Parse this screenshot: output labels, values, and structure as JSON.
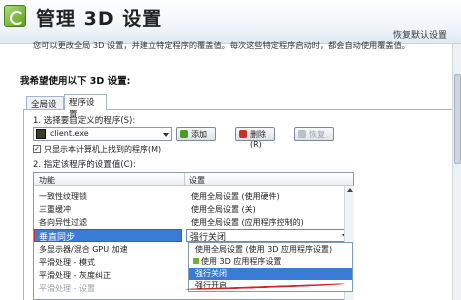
{
  "header": {
    "title": "管理 3D 设置",
    "restore_defaults": "恢复默认设置"
  },
  "description": "您可以更改全局 3D 设置，并建立特定程序的覆盖值。每次这些特定程序启动时，都会自动使用覆盖值。",
  "section_heading": "我希望使用以下 3D 设置:",
  "tabs": [
    {
      "label": "全局设置",
      "active": false
    },
    {
      "label": "程序设置",
      "active": true
    }
  ],
  "program_settings": {
    "step1_label": "1. 选择要自定义的程序(S):",
    "selected_program": "client.exe",
    "add_label": "添加",
    "remove_label": "删除(R)",
    "restore_label": "恢复",
    "checkbox_label": "只显示本计算机上找到的程序(M)",
    "checkbox_checked": true,
    "step2_label": "2. 指定该程序的设置值(C):"
  },
  "settings_table": {
    "columns": [
      "功能",
      "设置"
    ],
    "rows": [
      {
        "feature": "一致性纹理锁",
        "setting": "使用全局设置 (使用硬件)"
      },
      {
        "feature": "三重缓冲",
        "setting": "使用全局设置 (关)"
      },
      {
        "feature": "各向异性过滤",
        "setting": "使用全局设置 (应用程序控制的)"
      },
      {
        "feature": "垂直同步",
        "setting": "强行关闭",
        "selected": true
      },
      {
        "feature": "多显示器/混合 GPU 加速",
        "setting": ""
      },
      {
        "feature": "平滑处理 - 模式",
        "setting": ""
      },
      {
        "feature": "平滑处理 - 灰度纠正",
        "setting": ""
      },
      {
        "feature": "平滑处理 - 设置",
        "setting": ""
      }
    ]
  },
  "dropdown": {
    "options": [
      {
        "label": "使用全局设置 (使用 3D 应用程序设置)"
      },
      {
        "label": "使用 3D 应用程序设置"
      },
      {
        "label": "强行关闭",
        "selected": true
      },
      {
        "label": "强行开启"
      }
    ]
  },
  "colors": {
    "selection": "#3a7bd5",
    "highlight_border": "#d22b2b",
    "brand_green": "#6ab32a"
  }
}
